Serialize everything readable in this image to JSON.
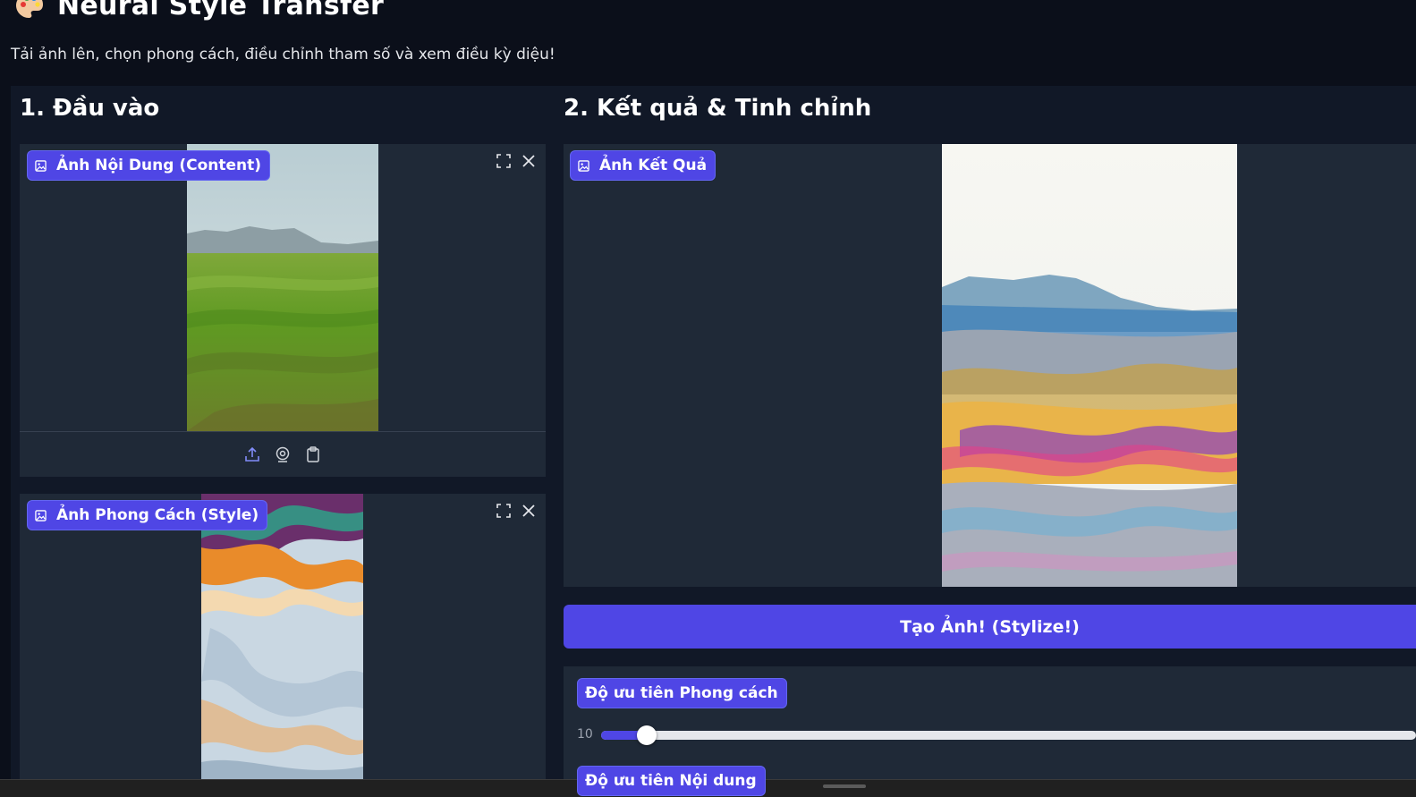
{
  "app": {
    "title": "Neural Style Transfer",
    "subtitle": "Tải ảnh lên, chọn phong cách, điều chỉnh tham số và xem điều kỳ diệu!",
    "icon": "palette-icon"
  },
  "input_section": {
    "heading": "1. Đầu vào",
    "content_image": {
      "label": "Ảnh Nội Dung (Content)",
      "controls": [
        "fullscreen-icon",
        "close-icon"
      ],
      "toolbar": [
        "upload-icon",
        "webcam-icon",
        "clipboard-icon"
      ]
    },
    "style_image": {
      "label": "Ảnh Phong Cách (Style)",
      "controls": [
        "fullscreen-icon",
        "close-icon"
      ]
    }
  },
  "output_section": {
    "heading": "2. Kết quả & Tinh chỉnh",
    "result_image": {
      "label": "Ảnh Kết Quả"
    },
    "stylize_button": "Tạo Ảnh! (Stylize!)",
    "style_weight": {
      "label": "Độ ưu tiên Phong cách",
      "value": "10",
      "fill_fraction": 0.056
    },
    "content_weight": {
      "label": "Độ ưu tiên Nội dung"
    }
  },
  "colors": {
    "accent": "#4f46e5",
    "background": "#0b0f1a",
    "panel": "#1f2937",
    "section": "#111827"
  }
}
